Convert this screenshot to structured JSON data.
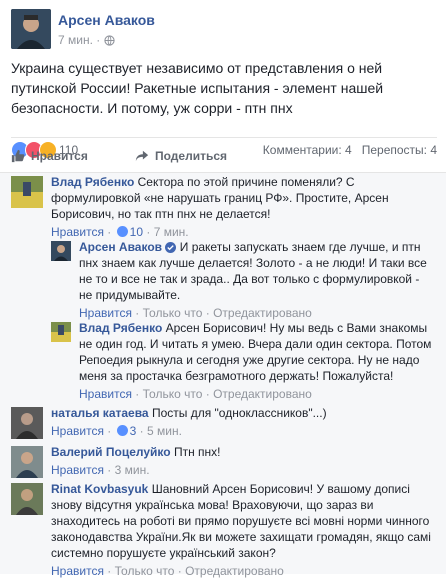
{
  "post": {
    "author": "Арсен Аваков",
    "time": "7 мин.",
    "text": "Украина существует независимо от представления о ней путинской России! Ракетные испытания - элемент нашей безопасности. И потому, уж сорри - птн пнх",
    "reactions_count": "110",
    "comments_count": "Комментарии: 4",
    "shares_count": "Перепосты: 4"
  },
  "actions": {
    "like": "Нравится",
    "share": "Поделиться"
  },
  "comments": [
    {
      "name": "Влад Рябенко",
      "text": "Сектора по этой причине поменяли? С формулировкой «не нарушать границ РФ». Простите, Арсен Борисович, но так птн пнх не делается!",
      "like": "Нравится",
      "likes": "10",
      "time": "7 мин."
    },
    {
      "name": "Арсен Аваков",
      "text": "И ракеты запускать знаем где лучше, и птн пнх знаем как лучше делается! Золото - а не люди! И таки все не то и все не так и зрада.. Да вот только с формулировкой - не придумывайте.",
      "like": "Нравится",
      "time": "Только что",
      "status": "Отредактировано"
    },
    {
      "name": "Влад Рябенко",
      "text": "Арсен Борисович! Ну мы ведь с Вами знакомы не один год. И читать я умею. Вчера дали один сектора. Потом Репоедия рыкнула и сегодня уже другие сектора. Ну не надо меня за простачка безграмотного держать! Пожалуйста!",
      "like": "Нравится",
      "time": "Только что",
      "status": "Отредактировано"
    },
    {
      "name": "наталья катаева",
      "text": "Посты для \"одноклассников\"...)",
      "like": "Нравится",
      "likes": "3",
      "time": "5 мин."
    },
    {
      "name": "Валерий Поцелуйко",
      "text": "Птн пнх!",
      "like": "Нравится",
      "time": "3 мин."
    },
    {
      "name": "Rinat Kovbasyuk",
      "text": "Шановний Арсен Борисович! У вашому дописі знову відсутня українська мова! Враховуючи, що зараз ви знаходитесь на роботі ви прямо порушуєте всі мовні норми чинного законодавства України.Як ви можете захищати громадян, якщо самі системно порушуєте український закон?",
      "like": "Нравится",
      "time": "Только что",
      "status": "Отредактировано"
    }
  ],
  "sep": "·",
  "colors": {
    "link": "#365899",
    "muted": "#90949c",
    "bg": "#f6f7f9"
  }
}
